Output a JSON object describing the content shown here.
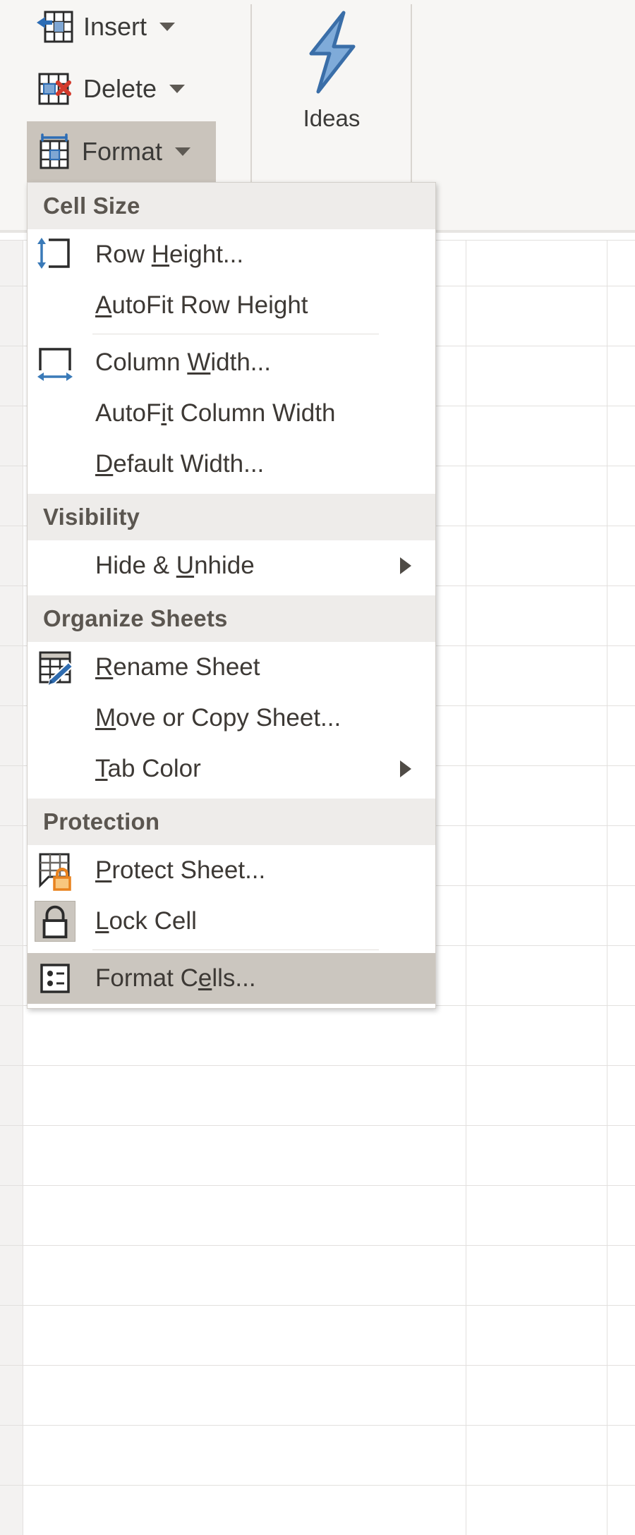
{
  "ribbon": {
    "buttons": [
      {
        "label": "Insert",
        "icon": "insert-cells-icon",
        "has_caret": true,
        "pressed": false
      },
      {
        "label": "Delete",
        "icon": "delete-cells-icon",
        "has_caret": true,
        "pressed": false
      },
      {
        "label": "Format",
        "icon": "format-cells-icon",
        "has_caret": true,
        "pressed": true
      }
    ],
    "ideas": {
      "label": "Ideas",
      "icon": "lightning-bolt-icon"
    }
  },
  "menu": {
    "name": "format-dropdown-menu",
    "sections": [
      {
        "header": "Cell Size",
        "items": [
          {
            "label": "Row Height...",
            "accel": "H",
            "icon": "row-height-icon",
            "submenu": false,
            "highlight": false
          },
          {
            "label": "AutoFit Row Height",
            "accel": "A",
            "icon": "none",
            "submenu": false,
            "highlight": false
          },
          {
            "separator": true
          },
          {
            "label": "Column Width...",
            "accel": "W",
            "icon": "column-width-icon",
            "submenu": false,
            "highlight": false
          },
          {
            "label": "AutoFit Column Width",
            "accel": "i",
            "icon": "none",
            "submenu": false,
            "highlight": false
          },
          {
            "label": "Default Width...",
            "accel": "D",
            "icon": "none",
            "submenu": false,
            "highlight": false
          }
        ]
      },
      {
        "header": "Visibility",
        "items": [
          {
            "label": "Hide & Unhide",
            "accel": "U",
            "icon": "none",
            "submenu": true,
            "highlight": false
          }
        ]
      },
      {
        "header": "Organize Sheets",
        "items": [
          {
            "label": "Rename Sheet",
            "accel": "R",
            "icon": "rename-sheet-icon",
            "submenu": false,
            "highlight": false
          },
          {
            "label": "Move or Copy Sheet...",
            "accel": "M",
            "icon": "none",
            "submenu": false,
            "highlight": false
          },
          {
            "label": "Tab Color",
            "accel": "T",
            "icon": "none",
            "submenu": true,
            "highlight": false
          }
        ]
      },
      {
        "header": "Protection",
        "items": [
          {
            "label": "Protect Sheet...",
            "accel": "P",
            "icon": "protect-sheet-icon",
            "submenu": false,
            "highlight": false
          },
          {
            "label": "Lock Cell",
            "accel": "L",
            "icon": "lock-icon",
            "icon_boxed": true,
            "submenu": false,
            "highlight": false
          },
          {
            "separator": true
          },
          {
            "label": "Format Cells...",
            "accel": "E",
            "icon": "format-cells-dialog-icon",
            "submenu": false,
            "highlight": true
          }
        ]
      }
    ]
  },
  "colors": {
    "menu_bg": "#ffffff",
    "section_header_bg": "#eeecea",
    "highlight_bg": "#cbc6bf",
    "ribbon_bg": "#f7f6f4",
    "accent_blue": "#4a7ebb",
    "lock_orange": "#e8821e",
    "text": "#3d3935",
    "grid_line": "#e2e0de"
  }
}
